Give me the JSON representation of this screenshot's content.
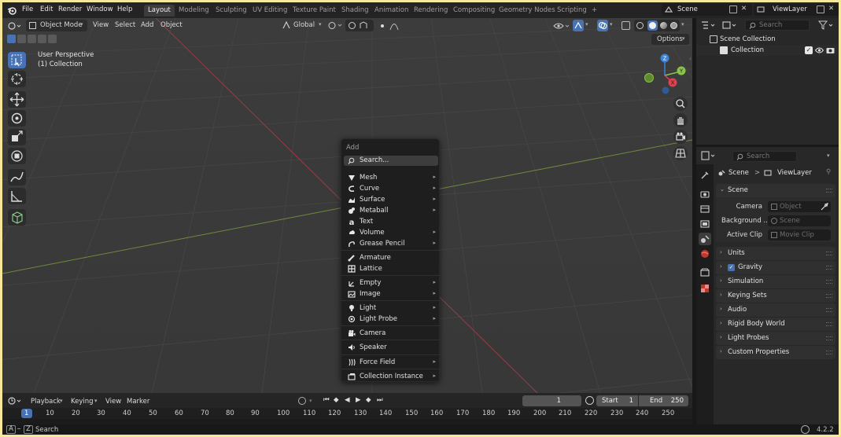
{
  "topbar": {
    "menus": [
      "File",
      "Edit",
      "Render",
      "Window",
      "Help"
    ],
    "workspaces": [
      "Layout",
      "Modeling",
      "Sculpting",
      "UV Editing",
      "Texture Paint",
      "Shading",
      "Animation",
      "Rendering",
      "Compositing",
      "Geometry Nodes",
      "Scripting"
    ],
    "active_workspace": "Layout",
    "add_workspace": "+",
    "scene": "Scene",
    "view_layer": "ViewLayer"
  },
  "viewport": {
    "header": {
      "mode": "Object Mode",
      "menus": [
        "View",
        "Select",
        "Add",
        "Object"
      ],
      "orientation": "Global",
      "options": "Options"
    },
    "overlay_text": [
      "User Perspective",
      "(1) Collection"
    ],
    "gizmo": {
      "z": "Z",
      "y": "Y",
      "x": "X"
    },
    "axis_colors": {
      "x": "#e0404f",
      "y": "#8ac34a",
      "z": "#3b83d8"
    }
  },
  "add_menu": {
    "title": "Add",
    "search": "Search...",
    "items": [
      {
        "label": "Mesh",
        "icon": "mesh-icon",
        "sub": true
      },
      {
        "label": "Curve",
        "icon": "curve-icon",
        "sub": true
      },
      {
        "label": "Surface",
        "icon": "surface-icon",
        "sub": true
      },
      {
        "label": "Metaball",
        "icon": "metaball-icon",
        "sub": true
      },
      {
        "label": "Text",
        "icon": "text-icon",
        "sub": false
      },
      {
        "label": "Volume",
        "icon": "volume-icon",
        "sub": true
      },
      {
        "label": "Grease Pencil",
        "icon": "grease-pencil-icon",
        "sub": true
      },
      {
        "label": "Armature",
        "icon": "armature-icon",
        "sub": false
      },
      {
        "label": "Lattice",
        "icon": "lattice-icon",
        "sub": false
      },
      {
        "label": "Empty",
        "icon": "empty-icon",
        "sub": true
      },
      {
        "label": "Image",
        "icon": "image-icon",
        "sub": true
      },
      {
        "label": "Light",
        "icon": "light-icon",
        "sub": true
      },
      {
        "label": "Light Probe",
        "icon": "light-probe-icon",
        "sub": true
      },
      {
        "label": "Camera",
        "icon": "camera-icon",
        "sub": false
      },
      {
        "label": "Speaker",
        "icon": "speaker-icon",
        "sub": false
      },
      {
        "label": "Force Field",
        "icon": "force-field-icon",
        "sub": true
      },
      {
        "label": "Collection Instance",
        "icon": "collection-instance-icon",
        "sub": true
      }
    ],
    "arrow": "▸"
  },
  "timeline": {
    "menus": [
      "Playback",
      "Keying",
      "View",
      "Marker"
    ],
    "current_frame": "1",
    "start_label": "Start",
    "start": "1",
    "end_label": "End",
    "end": "250",
    "ticks": [
      "1",
      "10",
      "20",
      "30",
      "40",
      "50",
      "60",
      "70",
      "80",
      "90",
      "100",
      "110",
      "120",
      "130",
      "140",
      "150",
      "160",
      "170",
      "180",
      "190",
      "200",
      "210",
      "220",
      "230",
      "240",
      "250"
    ]
  },
  "status": {
    "key_a": "A",
    "key_z": "Z",
    "search": "Search",
    "version": "4.2.2"
  },
  "outliner": {
    "search_placeholder": "Search",
    "scene_collection": "Scene Collection",
    "collection": "Collection"
  },
  "properties": {
    "search_placeholder": "Search",
    "breadcrumb_scene": "Scene",
    "breadcrumb_sep": ">",
    "breadcrumb_layer": "ViewLayer",
    "scene_panel": "Scene",
    "fields": [
      {
        "label": "Camera",
        "placeholder": "Object"
      },
      {
        "label": "Background ...",
        "placeholder": "Scene"
      },
      {
        "label": "Active Clip",
        "placeholder": "Movie Clip"
      }
    ],
    "panels": [
      "Units",
      "Gravity",
      "Simulation",
      "Keying Sets",
      "Audio",
      "Rigid Body World",
      "Light Probes",
      "Custom Properties"
    ]
  }
}
